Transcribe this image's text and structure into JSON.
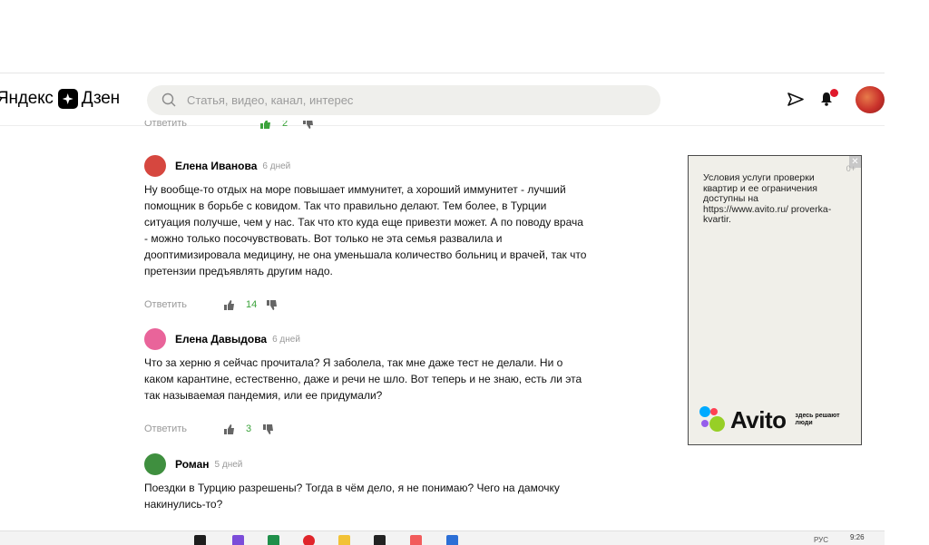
{
  "header": {
    "logo_left": "Яндекс",
    "logo_right": "Дзен",
    "search_placeholder": "Статья, видео, канал, интерес"
  },
  "partial_comment": {
    "reply_label": "Ответить",
    "likes": "2"
  },
  "comments": [
    {
      "name": "Елена Иванова",
      "time": "6 дней",
      "text": "Ну вообще-то отдых на море повышает иммунитет, а хороший иммунитет - лучший помощник в борьбе с ковидом. Так что правильно делают. Тем более, в Турции ситуация получше, чем у нас. Так что кто куда еще привезти может. А по поводу врача - можно только посочувствовать. Вот только не эта семья развалила и дооптимизировала медицину, не она уменьшала количество больниц и врачей, так что претензии предъявлять другим надо.",
      "reply_label": "Ответить",
      "likes": "14",
      "avatar_color": "#d6473f"
    },
    {
      "name": "Елена Давыдова",
      "time": "6 дней",
      "text": "Что за херню я сейчас прочитала? Я заболела, так мне даже тест не делали. Ни о каком карантине, естественно, даже и речи не шло. Вот теперь и не знаю, есть ли эта так называемая пандемия, или ее придумали?",
      "reply_label": "Ответить",
      "likes": "3",
      "avatar_color": "#e9649a"
    },
    {
      "name": "Роман",
      "time": "5 дней",
      "text": "Поездки в Турцию разрешены? Тогда в чём дело, я не понимаю? Чего на дамочку накинулись-то?",
      "avatar_color": "#3f8f3f"
    }
  ],
  "ad": {
    "text": "Условия услуги проверки квартир и ее ограничения доступны на https://www.avito.ru/ proverka-kvartir.",
    "age": "0+",
    "close": "✕",
    "brand": "Avito",
    "tagline": "здесь решают люди"
  },
  "taskbar": {
    "time": "9:26",
    "lang": "РУС"
  },
  "colors": {
    "accent_like": "#3ba33b",
    "notification": "#e0192b"
  }
}
